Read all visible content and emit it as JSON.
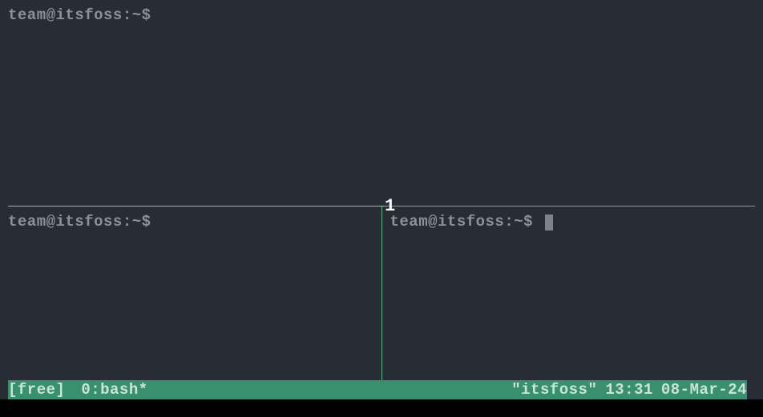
{
  "panes": {
    "top": {
      "prompt": "team@itsfoss:~$"
    },
    "bottom_left": {
      "prompt": "team@itsfoss:~$"
    },
    "bottom_right": {
      "prompt": "team@itsfoss:~$"
    }
  },
  "annotation": {
    "number": "1"
  },
  "status_bar": {
    "session_label": "[free]",
    "window_label": "0:bash*",
    "hostname": "\"itsfoss\"",
    "time": "13:31",
    "date": "08-Mar-24"
  }
}
